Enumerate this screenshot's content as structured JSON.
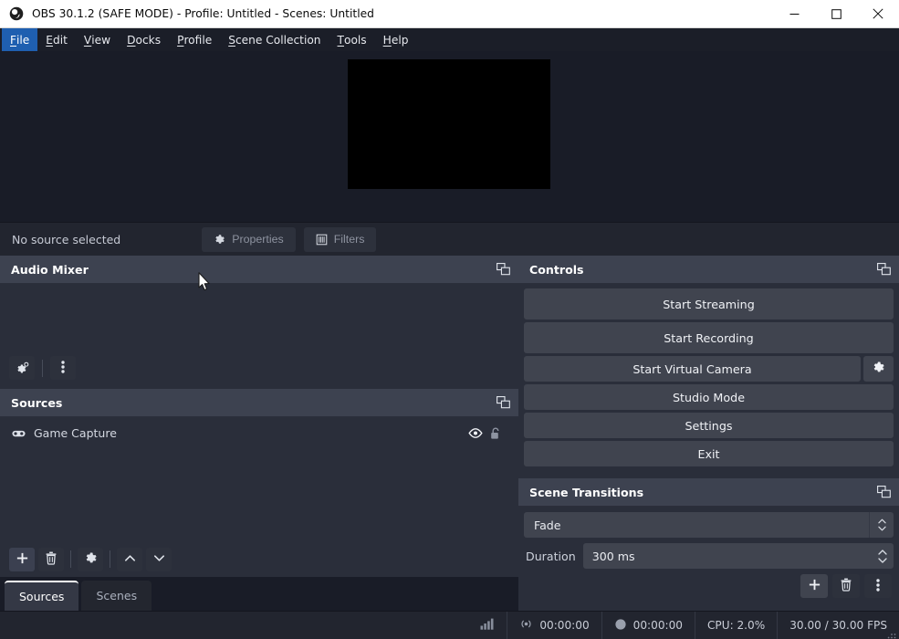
{
  "window": {
    "title": "OBS 30.1.2 (SAFE MODE) - Profile: Untitled - Scenes: Untitled",
    "logo_icon": "obs-logo-icon",
    "minimize_icon": "minimize-icon",
    "maximize_icon": "maximize-icon",
    "close_icon": "close-icon"
  },
  "menubar": {
    "items": [
      {
        "label": "File",
        "mnemonic": "F",
        "rest": "ile",
        "active": true
      },
      {
        "label": "Edit",
        "mnemonic": "E",
        "rest": "dit",
        "active": false
      },
      {
        "label": "View",
        "mnemonic": "V",
        "rest": "iew",
        "active": false
      },
      {
        "label": "Docks",
        "mnemonic": "D",
        "rest": "ocks",
        "active": false
      },
      {
        "label": "Profile",
        "mnemonic": "P",
        "rest": "rofile",
        "active": false
      },
      {
        "label": "Scene Collection",
        "mnemonic": "S",
        "rest": "cene Collection",
        "active": false
      },
      {
        "label": "Tools",
        "mnemonic": "T",
        "rest": "ools",
        "active": false
      },
      {
        "label": "Help",
        "mnemonic": "H",
        "rest": "elp",
        "active": false
      }
    ]
  },
  "preview": {
    "canvas_color": "#000000"
  },
  "source_toolbar": {
    "status": "No source selected",
    "properties_label": "Properties",
    "properties_icon": "gear-icon",
    "filters_label": "Filters",
    "filters_icon": "filters-icon"
  },
  "audio_mixer": {
    "title": "Audio Mixer",
    "undock_icon": "undock-icon",
    "settings_icon": "audio-settings-gear-icon",
    "menu_icon": "vertical-dots-icon",
    "channels": []
  },
  "sources": {
    "title": "Sources",
    "undock_icon": "undock-icon",
    "items": [
      {
        "name": "Game Capture",
        "type_icon": "gamepad-icon",
        "visible": true,
        "visibility_icon": "eye-icon",
        "locked": false,
        "lock_icon": "unlock-icon"
      }
    ],
    "toolbar": [
      {
        "name": "add-source-button",
        "icon": "plus-icon"
      },
      {
        "name": "remove-source-button",
        "icon": "trash-icon"
      },
      {
        "name": "source-properties-button",
        "icon": "gear-icon"
      },
      {
        "name": "move-source-up-button",
        "icon": "chevron-up-icon"
      },
      {
        "name": "move-source-down-button",
        "icon": "chevron-down-icon"
      }
    ],
    "tabs": [
      {
        "label": "Sources",
        "active": true
      },
      {
        "label": "Scenes",
        "active": false
      }
    ]
  },
  "controls": {
    "title": "Controls",
    "undock_icon": "undock-icon",
    "start_streaming": "Start Streaming",
    "start_recording": "Start Recording",
    "start_virtual_camera": "Start Virtual Camera",
    "virtual_camera_config_icon": "gear-icon",
    "studio_mode": "Studio Mode",
    "settings": "Settings",
    "exit": "Exit"
  },
  "scene_transitions": {
    "title": "Scene Transitions",
    "undock_icon": "undock-icon",
    "transition": "Fade",
    "duration_label": "Duration",
    "duration_value": "300 ms",
    "add_icon": "plus-icon",
    "remove_icon": "trash-icon",
    "menu_icon": "vertical-dots-icon"
  },
  "statusbar": {
    "signal_icon": "signal-bars-icon",
    "stream_icon": "broadcast-icon",
    "stream_time": "00:00:00",
    "record_icon": "record-dot-icon",
    "record_time": "00:00:00",
    "cpu": "CPU: 2.0%",
    "fps": "30.00 / 30.00 FPS",
    "grip_icon": "resize-grip-icon"
  },
  "colors": {
    "window_bg": "#191c27",
    "panel_header": "#3d4250",
    "panel_body": "#2a2e3a",
    "button": "#40444f",
    "menu_active": "#1f5fb0",
    "text": "#e7e9ee"
  }
}
